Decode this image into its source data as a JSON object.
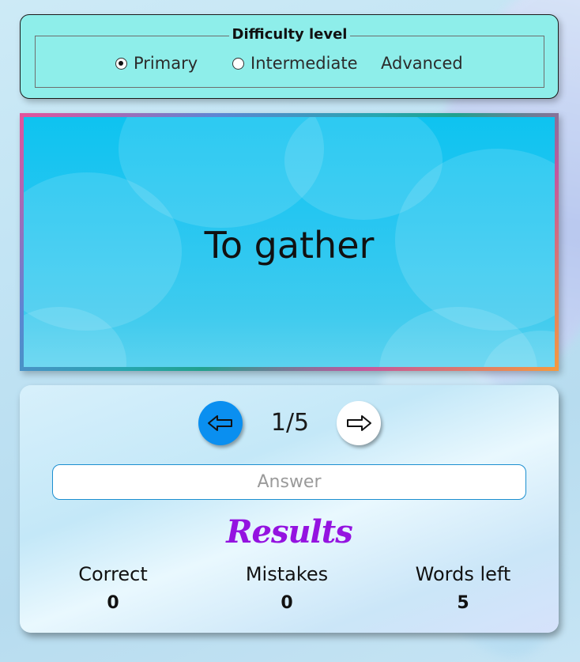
{
  "difficulty": {
    "legend": "Difficulty level",
    "options": [
      {
        "label": "Primary",
        "checked": true
      },
      {
        "label": "Intermediate",
        "checked": false
      },
      {
        "label": "Advanced",
        "checked": false
      }
    ]
  },
  "card": {
    "word": "To gather"
  },
  "navigation": {
    "prev_icon": "left-arrow-icon",
    "next_icon": "right-arrow-icon",
    "counter": "1/5"
  },
  "answer": {
    "value": "",
    "placeholder": "Answer"
  },
  "results": {
    "title": "Results",
    "correct_label": "Correct",
    "correct_value": "0",
    "mistakes_label": "Mistakes",
    "mistakes_value": "0",
    "words_left_label": "Words left",
    "words_left_value": "5"
  },
  "colors": {
    "difficulty_bg": "#8eeeea",
    "card_bg": "#1ec4f0",
    "prev_button": "#0a8ff0",
    "next_button": "#ffffff",
    "results_title": "#9413e0"
  }
}
